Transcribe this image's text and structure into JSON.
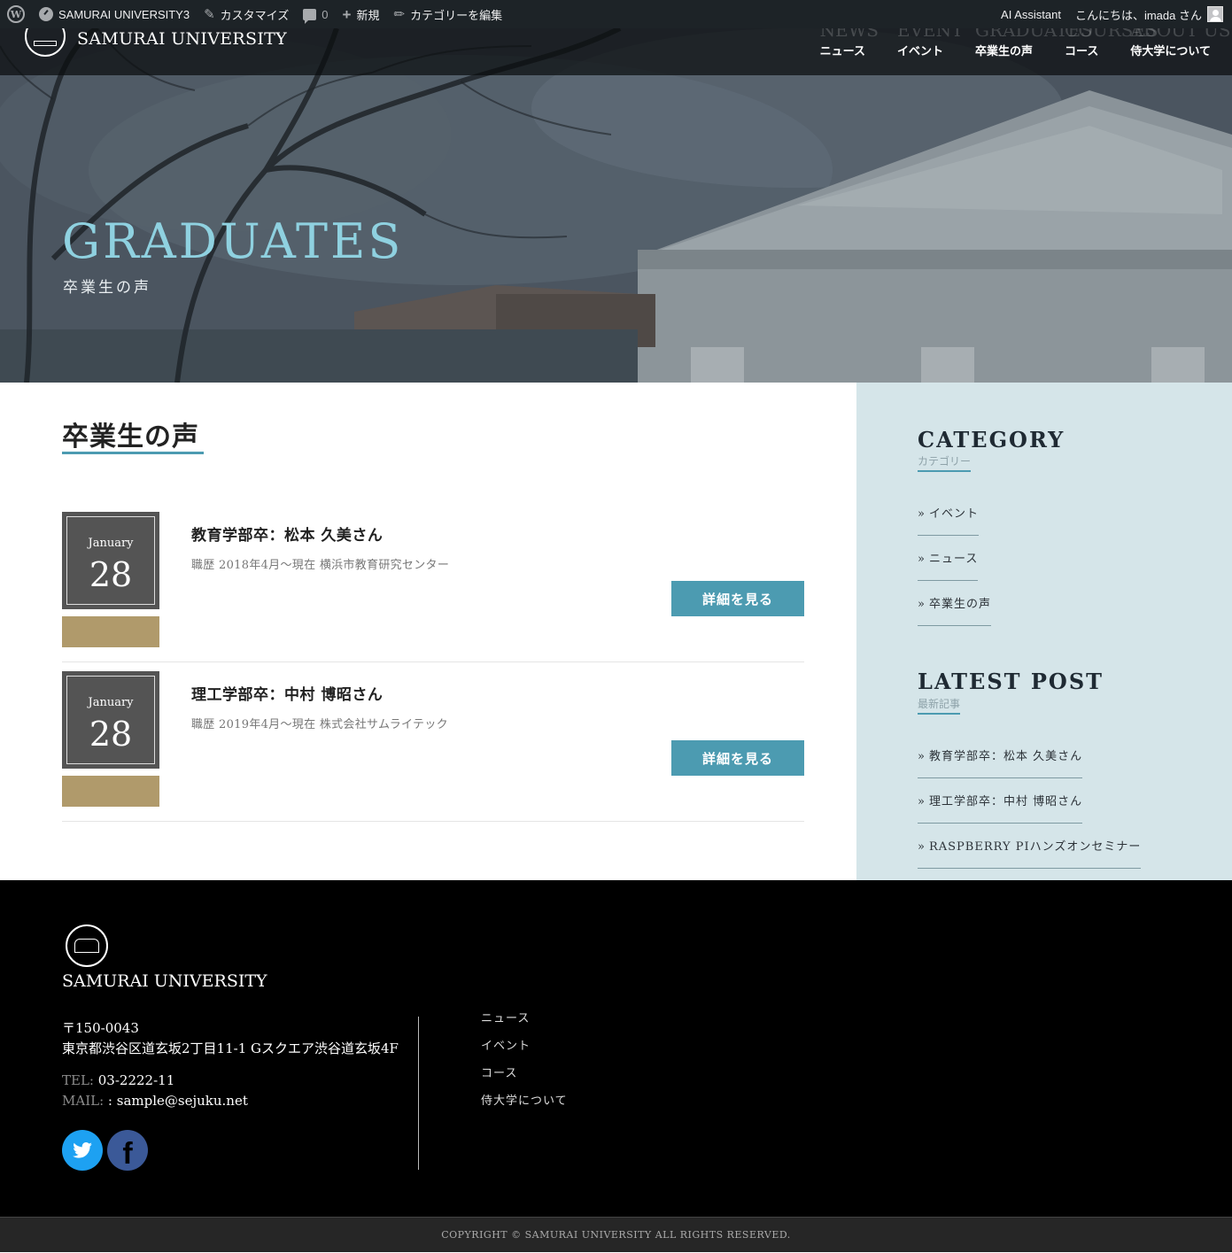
{
  "adminbar": {
    "wp_icon": "wordpress-icon",
    "site_name": "SAMURAI UNIVERSITY3",
    "customize": "カスタマイズ",
    "comments_count": "0",
    "new": "新規",
    "edit_category": "カテゴリーを編集",
    "ai_assistant": "AI Assistant",
    "greeting": "こんにちは、imada さん"
  },
  "site": {
    "title": "SAMURAI UNIVERSITY"
  },
  "nav": [
    {
      "en": "NEWS",
      "ja": "ニュース"
    },
    {
      "en": "EVENT",
      "ja": "イベント"
    },
    {
      "en": "GRADUATES",
      "ja": "卒業生の声"
    },
    {
      "en": "COURSES",
      "ja": "コース"
    },
    {
      "en": "ABOUT US",
      "ja": "侍大学について"
    }
  ],
  "hero": {
    "title": "GRADUATES",
    "subtitle": "卒業生の声"
  },
  "main": {
    "heading": "卒業生の声",
    "posts": [
      {
        "month": "January",
        "day": "28",
        "title": "教育学部卒：松本 久美さん",
        "meta": "職歴 2018年4月〜現在 横浜市教育研究センター",
        "button": "詳細を見る"
      },
      {
        "month": "January",
        "day": "28",
        "title": "理工学部卒：中村 博昭さん",
        "meta": "職歴 2019年4月〜現在 株式会社サムライテック",
        "button": "詳細を見る"
      }
    ]
  },
  "sidebar": {
    "category": {
      "title": "CATEGORY",
      "sub": "カテゴリー",
      "items": [
        "イベント",
        "ニュース",
        "卒業生の声"
      ]
    },
    "latest": {
      "title": "LATEST POST",
      "sub": "最新記事",
      "items": [
        "教育学部卒：松本 久美さん",
        "理工学部卒：中村 博昭さん",
        "RASPBERRY PIハンズオンセミナー"
      ]
    }
  },
  "footer": {
    "name": "SAMURAI UNIVERSITY",
    "postal": "〒150-0043",
    "address": "東京都渋谷区道玄坂2丁目11-1 Gスクエア渋谷道玄坂4F",
    "tel_label": "TEL:",
    "tel": "03-2222-11",
    "mail_label": "MAIL:",
    "mail": ": sample@sejuku.net",
    "nav": [
      "ニュース",
      "イベント",
      "コース",
      "侍大学について"
    ],
    "copyright": "COPYRIGHT © SAMURAI UNIVERSITY ALL RIGHTS RESERVED."
  }
}
